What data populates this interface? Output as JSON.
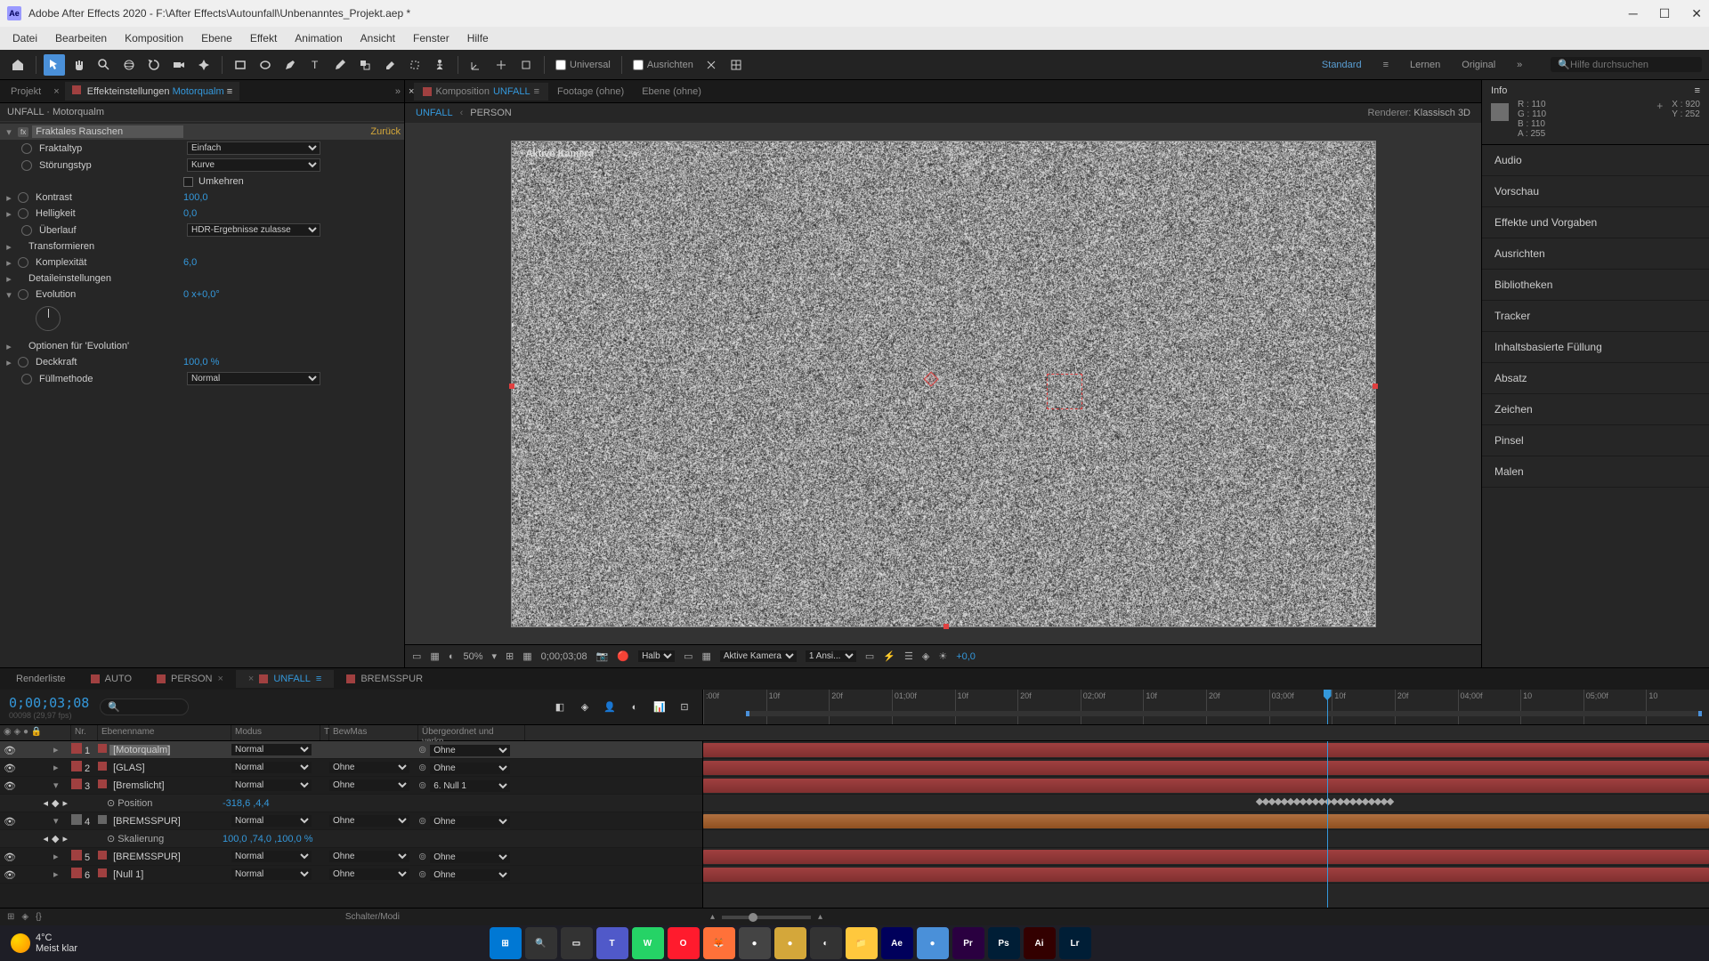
{
  "window": {
    "title": "Adobe After Effects 2020 - F:\\After Effects\\Autounfall\\Unbenanntes_Projekt.aep *"
  },
  "menu": [
    "Datei",
    "Bearbeiten",
    "Komposition",
    "Ebene",
    "Effekt",
    "Animation",
    "Ansicht",
    "Fenster",
    "Hilfe"
  ],
  "toolbar": {
    "universal": "Universal",
    "ausrichten": "Ausrichten",
    "workspaces": {
      "standard": "Standard",
      "lernen": "Lernen",
      "original": "Original"
    },
    "search_placeholder": "Hilfe durchsuchen"
  },
  "left": {
    "tabs": {
      "projekt": "Projekt",
      "effekte": "Effekteinstellungen",
      "effekte_layer": "Motorqualm"
    },
    "header": "UNFALL · Motorqualm",
    "effect_name": "Fraktales Rauschen",
    "reset": "Zurück",
    "props": {
      "fraktaltyp": "Fraktaltyp",
      "fraktaltyp_val": "Einfach",
      "stoerungstyp": "Störungstyp",
      "stoerungstyp_val": "Kurve",
      "umkehren": "Umkehren",
      "kontrast": "Kontrast",
      "kontrast_val": "100,0",
      "helligkeit": "Helligkeit",
      "helligkeit_val": "0,0",
      "ueberlauf": "Überlauf",
      "ueberlauf_val": "HDR-Ergebnisse zulasse",
      "transformieren": "Transformieren",
      "komplexitaet": "Komplexität",
      "komplexitaet_val": "6,0",
      "detail": "Detaileinstellungen",
      "evolution": "Evolution",
      "evolution_val": "0 x+0,0°",
      "evo_options": "Optionen für 'Evolution'",
      "deckkraft": "Deckkraft",
      "deckkraft_val": "100,0 %",
      "fuellmethode": "Füllmethode",
      "fuellmethode_val": "Normal"
    }
  },
  "center": {
    "tabs": {
      "komposition": "Komposition",
      "comp_name": "UNFALL",
      "footage": "Footage (ohne)",
      "ebene": "Ebene (ohne)"
    },
    "breadcrumb": {
      "unfall": "UNFALL",
      "person": "PERSON"
    },
    "renderer_label": "Renderer:",
    "renderer_value": "Klassisch 3D",
    "camera": "Aktive Kamera",
    "viewer": {
      "zoom": "50%",
      "timecode": "0;00;03;08",
      "res": "Halb",
      "camera_sel": "Aktive Kamera",
      "views": "1 Ansi...",
      "exposure": "+0,0"
    }
  },
  "right": {
    "info": "Info",
    "R": "R :",
    "R_val": "110",
    "G": "G :",
    "G_val": "110",
    "B": "B :",
    "B_val": "110",
    "A": "A :",
    "A_val": "255",
    "X": "X :",
    "X_val": "920",
    "Y": "Y :",
    "Y_val": "252",
    "panels": [
      "Audio",
      "Vorschau",
      "Effekte und Vorgaben",
      "Ausrichten",
      "Bibliotheken",
      "Tracker",
      "Inhaltsbasierte Füllung",
      "Absatz",
      "Zeichen",
      "Pinsel",
      "Malen"
    ]
  },
  "timeline": {
    "tabs": [
      "Renderliste",
      "AUTO",
      "PERSON",
      "UNFALL",
      "BREMSSPUR"
    ],
    "active_tab": 3,
    "timecode": "0;00;03;08",
    "frame_info": "00098 (29,97 fps)",
    "columns": {
      "nr": "Nr.",
      "name": "Ebenenname",
      "modus": "Modus",
      "t": "T",
      "bewmas": "BewMas",
      "parent": "Übergeordnet und verkn..."
    },
    "ruler": [
      ":00f",
      "10f",
      "20f",
      "01;00f",
      "10f",
      "20f",
      "02;00f",
      "10f",
      "20f",
      "03;00f",
      "10f",
      "20f",
      "04;00f",
      "10",
      "05;00f",
      "10"
    ],
    "layers": [
      {
        "num": "1",
        "name": "[Motorqualm]",
        "color": "#a04040",
        "mode": "Normal",
        "trkmat": "",
        "parent": "Ohne",
        "selected": true
      },
      {
        "num": "2",
        "name": "[GLAS]",
        "color": "#a04040",
        "mode": "Normal",
        "trkmat": "Ohne",
        "parent": "Ohne"
      },
      {
        "num": "3",
        "name": "[Bremslicht]",
        "color": "#a04040",
        "mode": "Normal",
        "trkmat": "Ohne",
        "parent": "6. Null 1",
        "expanded": true,
        "sub": [
          {
            "name": "Position",
            "value": "-318,6 ,4,4"
          }
        ]
      },
      {
        "num": "4",
        "name": "[BREMSSPUR]",
        "color": "#666",
        "mode": "Normal",
        "trkmat": "Ohne",
        "parent": "Ohne",
        "expanded": true,
        "sub": [
          {
            "name": "Skalierung",
            "value": "100,0 ,74,0 ,100,0 %"
          }
        ]
      },
      {
        "num": "5",
        "name": "[BREMSSPUR]",
        "color": "#a04040",
        "mode": "Normal",
        "trkmat": "Ohne",
        "parent": "Ohne"
      },
      {
        "num": "6",
        "name": "[Null 1]",
        "color": "#a04040",
        "mode": "Normal",
        "trkmat": "Ohne",
        "parent": "Ohne"
      }
    ],
    "footer": "Schalter/Modi"
  },
  "taskbar": {
    "temp": "4°C",
    "condition": "Meist klar",
    "apps": [
      {
        "name": "start",
        "bg": "#0078d4",
        "txt": "⊞"
      },
      {
        "name": "search",
        "bg": "#333",
        "txt": "🔍"
      },
      {
        "name": "taskview",
        "bg": "#333",
        "txt": "▭"
      },
      {
        "name": "teams",
        "bg": "#5059c9",
        "txt": "T"
      },
      {
        "name": "whatsapp",
        "bg": "#25d366",
        "txt": "W"
      },
      {
        "name": "opera",
        "bg": "#ff1b2d",
        "txt": "O"
      },
      {
        "name": "firefox",
        "bg": "#ff7139",
        "txt": "🦊"
      },
      {
        "name": "app1",
        "bg": "#444",
        "txt": "●"
      },
      {
        "name": "app2",
        "bg": "#d4a73a",
        "txt": "●"
      },
      {
        "name": "app3",
        "bg": "#333",
        "txt": "◐"
      },
      {
        "name": "explorer",
        "bg": "#ffc83d",
        "txt": "📁"
      },
      {
        "name": "ae",
        "bg": "#00005b",
        "txt": "Ae"
      },
      {
        "name": "app4",
        "bg": "#4a90d9",
        "txt": "●"
      },
      {
        "name": "pr",
        "bg": "#2a0040",
        "txt": "Pr"
      },
      {
        "name": "ps",
        "bg": "#001e36",
        "txt": "Ps"
      },
      {
        "name": "ai",
        "bg": "#330000",
        "txt": "Ai"
      },
      {
        "name": "lr",
        "bg": "#001e36",
        "txt": "Lr"
      }
    ]
  }
}
